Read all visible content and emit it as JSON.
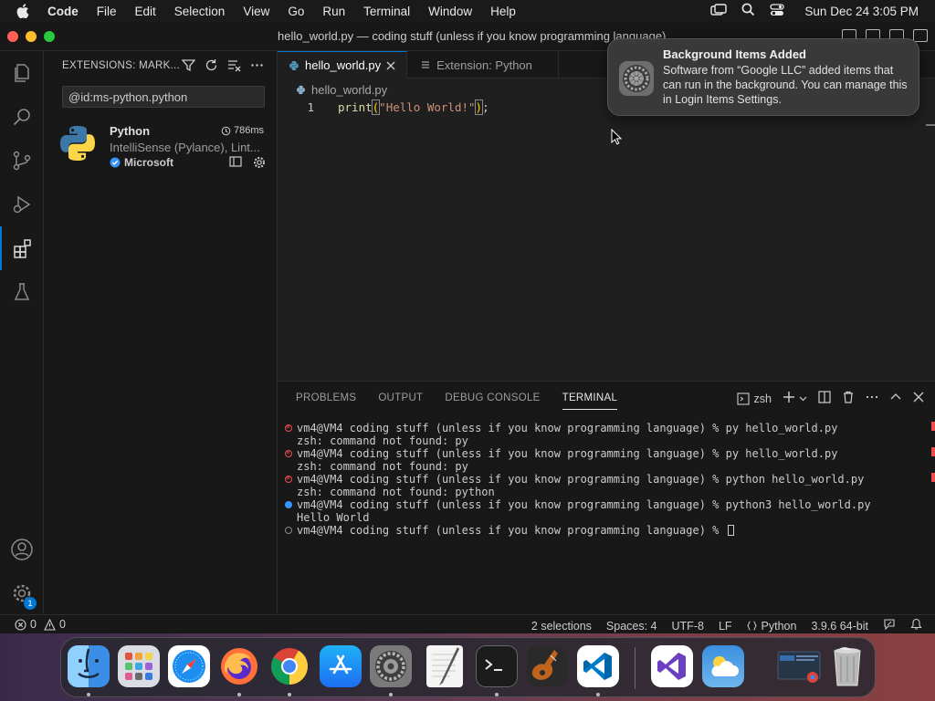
{
  "menubar": {
    "app_name": "Code",
    "items": [
      "File",
      "Edit",
      "Selection",
      "View",
      "Go",
      "Run",
      "Terminal",
      "Window",
      "Help"
    ],
    "clock": "Sun Dec 24  3:05 PM"
  },
  "window": {
    "title": "hello_world.py — coding stuff (unless if you know programming language)"
  },
  "sidebar": {
    "title": "EXTENSIONS: MARK...",
    "search_value": "@id:ms-python.python",
    "extension": {
      "name": "Python",
      "time": "786ms",
      "description": "IntelliSense (Pylance), Lint...",
      "publisher": "Microsoft"
    }
  },
  "activity_bar": {
    "accounts_badge": "1"
  },
  "editor": {
    "tabs": [
      {
        "label": "hello_world.py",
        "active": true
      },
      {
        "label": "Extension: Python",
        "active": false
      }
    ],
    "breadcrumb": "hello_world.py",
    "lines": [
      {
        "number": "1",
        "fn": "print",
        "open": "(",
        "string": "\"Hello World!\"",
        "close": ")",
        "end": ";"
      }
    ]
  },
  "panel": {
    "tabs": [
      "PROBLEMS",
      "OUTPUT",
      "DEBUG CONSOLE",
      "TERMINAL"
    ],
    "active_tab": "TERMINAL",
    "shell": "zsh",
    "terminal_lines": [
      {
        "status": "error",
        "text": "vm4@VM4 coding stuff (unless if you know programming language) % py hello_world.py"
      },
      {
        "status": "none",
        "text": "zsh: command not found: py"
      },
      {
        "status": "error",
        "text": "vm4@VM4 coding stuff (unless if you know programming language) % py hello_world.py"
      },
      {
        "status": "none",
        "text": "zsh: command not found: py"
      },
      {
        "status": "error",
        "text": "vm4@VM4 coding stuff (unless if you know programming language) % python hello_world.py"
      },
      {
        "status": "none",
        "text": "zsh: command not found: python"
      },
      {
        "status": "success",
        "text": "vm4@VM4 coding stuff (unless if you know programming language) % python3 hello_world.py"
      },
      {
        "status": "none",
        "text": "Hello World"
      },
      {
        "status": "idle",
        "text": "vm4@VM4 coding stuff (unless if you know programming language) % "
      }
    ]
  },
  "statusbar": {
    "errors": "0",
    "warnings": "0",
    "selections": "2 selections",
    "spaces": "Spaces: 4",
    "encoding": "UTF-8",
    "eol": "LF",
    "language": "Python",
    "interpreter": "3.9.6 64-bit"
  },
  "notification": {
    "title": "Background Items Added",
    "body": "Software from “Google LLC” added items that can run in the background. You can manage this in Login Items Settings."
  },
  "dock": {
    "apps": [
      "finder-icon",
      "launchpad-icon",
      "safari-icon",
      "firefox-icon",
      "chrome-icon",
      "app-store-icon",
      "system-settings-icon",
      "textedit-icon",
      "terminal-icon",
      "garageband-icon",
      "vscode-icon",
      "visual-studio-icon",
      "weather-icon",
      "window-preview-icon",
      "trash-icon"
    ]
  },
  "colors": {
    "accent": "#0078d4",
    "error": "#f14c4c",
    "success": "#3794ff"
  }
}
